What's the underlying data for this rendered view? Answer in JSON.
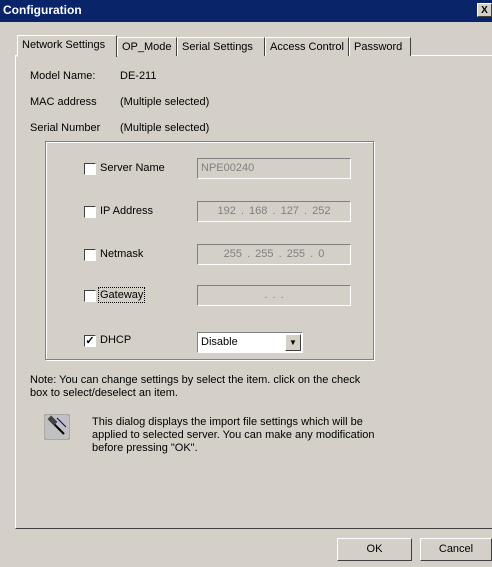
{
  "window": {
    "title": "Configuration",
    "close_label": "X"
  },
  "tabs": [
    {
      "label": "Network Settings",
      "active": true
    },
    {
      "label": "OP_Mode"
    },
    {
      "label": "Serial Settings"
    },
    {
      "label": "Access Control"
    },
    {
      "label": "Password"
    }
  ],
  "info": {
    "model_label": "Model Name:",
    "model_value": "DE-211",
    "mac_label": "MAC address",
    "mac_value": "(Multiple selected)",
    "serial_label": "Serial Number",
    "serial_value": "(Multiple selected)"
  },
  "fields": {
    "server_name": {
      "label": "Server Name",
      "value": "NPE00240",
      "checked": false
    },
    "ip_address": {
      "label": "IP Address",
      "value": "192 . 168 . 127 . 252",
      "checked": false
    },
    "netmask": {
      "label": "Netmask",
      "value": "255 . 255 . 255 . 0",
      "checked": false
    },
    "gateway": {
      "label": "Gateway",
      "value": ". . .",
      "checked": false
    },
    "dhcp": {
      "label": "DHCP",
      "value": "Disable",
      "checked": true,
      "check_mark": "✓"
    }
  },
  "note": "Note: You can change settings by select the item. click on the check box to select/deselect an item.",
  "info_message": "This dialog displays the import file settings which will be applied to selected server. You can make any modification before pressing \"OK\".",
  "buttons": {
    "ok": "OK",
    "cancel": "Cancel"
  }
}
